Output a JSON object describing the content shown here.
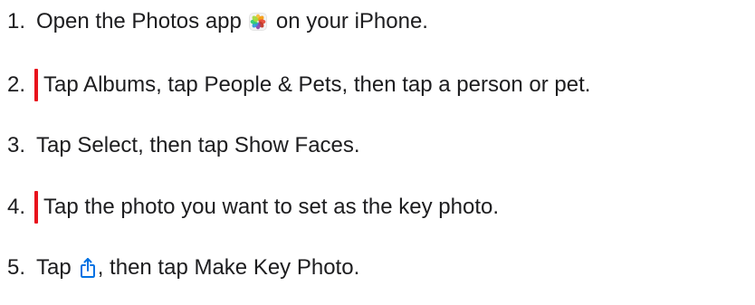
{
  "steps": [
    {
      "number": "1.",
      "before_icon": "Open the Photos app",
      "icon": "photos-app-icon",
      "after_icon": "on your iPhone.",
      "highlighted": false
    },
    {
      "number": "2.",
      "text": "Tap Albums, tap People & Pets, then tap a person or pet.",
      "highlighted": true
    },
    {
      "number": "3.",
      "text": "Tap Select, then tap Show Faces.",
      "highlighted": false
    },
    {
      "number": "4.",
      "text": "Tap the photo you want to set as the key photo.",
      "highlighted": true
    },
    {
      "number": "5.",
      "before_icon": "Tap",
      "icon": "share-icon",
      "after_icon": ", then tap Make Key Photo.",
      "highlighted": false
    }
  ],
  "colors": {
    "text": "#1d1d1f",
    "highlight_marker": "#e8111c",
    "share_icon": "#0071e3",
    "background": "#ffffff"
  }
}
